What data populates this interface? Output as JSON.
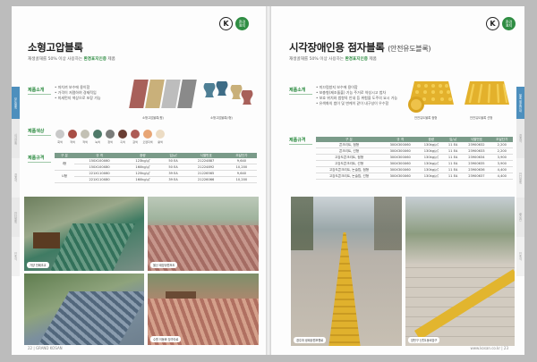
{
  "left": {
    "title": "소형고압블록",
    "subtitle_prefix": "재생골재를 50% 이상 사용하는",
    "subtitle_brand": "환경표지인증",
    "subtitle_suffix": "제품",
    "features_heading": "제품소개",
    "features": [
      "• 마치끼 보수에 용이함",
      "• 가격이 저렴하여 경제적임",
      "• 미세먼지 색상으로 포장 가능"
    ],
    "block_caption_1": "소형고압블록(평)",
    "block_caption_2": "소형고압블록(I형)",
    "colors_heading": "제품색상",
    "colors": [
      {
        "name": "회색",
        "hex": "#c9c9c9"
      },
      {
        "name": "적색",
        "hex": "#a84e46"
      },
      {
        "name": "적색",
        "hex": "#c3c1b4"
      },
      {
        "name": "녹색",
        "hex": "#4f7a69"
      },
      {
        "name": "청색",
        "hex": "#7a7c7a"
      },
      {
        "name": "흑색",
        "hex": "#6a3e34"
      },
      {
        "name": "갈색",
        "hex": "#ad5b55"
      },
      {
        "name": "오렌지색",
        "hex": "#e8a574"
      },
      {
        "name": "황색",
        "hex": "#ecdcc4"
      }
    ],
    "spec_heading": "제품규격",
    "table": {
      "headers": [
        "구 분",
        "규 격",
        "중량",
        "입/㎡",
        "식별번호",
        "조달단가"
      ],
      "rows": [
        [
          "I형",
          "150X100X60",
          "123kg/㎡",
          "50 EA",
          "21224887",
          "9,640"
        ],
        [
          "",
          "150X100X80",
          "160kg/㎡",
          "50 EA",
          "21224892",
          "10,200"
        ],
        [
          "U형",
          "221X110X60",
          "125kg/㎡",
          "39 EA",
          "21226565",
          "9,640"
        ],
        [
          "",
          "221X110X80",
          "160kg/㎡",
          "39 EA",
          "21226066",
          "10,200"
        ]
      ]
    },
    "photo_captions": [
      "가양 전폐초교",
      "울산 태양공원보도",
      "",
      "수원 이동화 장가야로"
    ],
    "folio": "22  |  GRAND KOSAN",
    "side_tabs": [
      "보도블록",
      "시각장애",
      "경계석",
      "잔디블록",
      "인조석"
    ]
  },
  "right": {
    "title": "시각장애인용 점자블록",
    "title_sub": "(안전유도블록)",
    "subtitle_prefix": "재생골재를 50% 이상 사용하는",
    "subtitle_brand": "환경표지인증",
    "subtitle_suffix": "제품",
    "features_heading": "제품소개",
    "features": [
      "• 미끄럼방지 보수에 용이함",
      "• 보충형(제조돌출) 기능 주거로 약성시고 범차",
      "• 보호 위치와 범항의 안내 등 위험을 도주의 요시 가능",
      "• 유색화의 범이 및 변케이 같이 내구성이 우수함"
    ],
    "block_caption_1": "안전유도블록 점형",
    "block_caption_2": "안전유도블록 선형",
    "spec_heading": "제품규격",
    "table": {
      "headers": [
        "구 분",
        "규 격",
        "중량",
        "입/㎡",
        "식별번호",
        "조달단가"
      ],
      "rows": [
        [
          "콘크리트, 점형",
          "300X300X60",
          "130kg/㎡",
          "11 EA",
          "23900632",
          "2,200"
        ],
        [
          "콘크리트, 선형",
          "300X300X60",
          "130kg/㎡",
          "11 EA",
          "23900633",
          "2,200"
        ],
        [
          "고강도콘크리트, 점형",
          "300X300X60",
          "130kg/㎡",
          "11 EA",
          "23900634",
          "3,900"
        ],
        [
          "고강도콘크리트, 선형",
          "300X300X60",
          "130kg/㎡",
          "11 EA",
          "23900635",
          "3,900"
        ],
        [
          "고강도콘크리트, 논슬립, 점형",
          "300X300X60",
          "130kg/㎡",
          "11 EA",
          "23900636",
          "4,400"
        ],
        [
          "고강도콘크리트, 논슬립, 선형",
          "300X300X60",
          "130kg/㎡",
          "11 EA",
          "23900637",
          "4,400"
        ]
      ]
    },
    "photo_captions": [
      "경주마 생태공원보행로",
      "양천구 신월1동비앙구"
    ],
    "folio": "www.kosan.co.kr  |  23",
    "side_tabs": [
      "블록 제품안내",
      "경계석",
      "잔디블록",
      "배수관",
      "인조석"
    ]
  }
}
